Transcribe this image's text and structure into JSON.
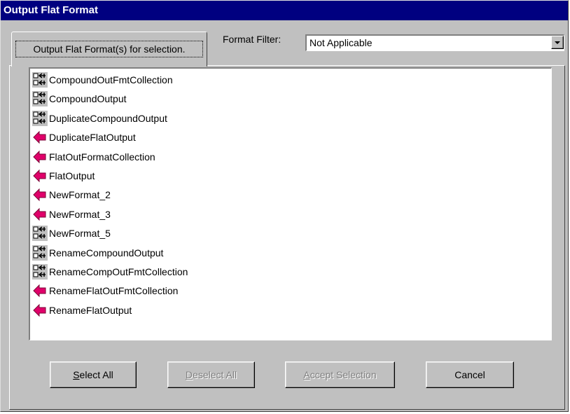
{
  "window": {
    "title": "Output Flat Format"
  },
  "tab": {
    "label": "Output Flat Format(s) for selection."
  },
  "filter": {
    "label": "Format Filter:",
    "value": "Not Applicable"
  },
  "list": {
    "items": [
      {
        "label": "CompoundOutFmtCollection",
        "icon": "compound-format-icon"
      },
      {
        "label": "CompoundOutput",
        "icon": "compound-format-icon"
      },
      {
        "label": "DuplicateCompoundOutput",
        "icon": "compound-format-icon"
      },
      {
        "label": "DuplicateFlatOutput",
        "icon": "flat-output-arrow-icon"
      },
      {
        "label": "FlatOutFormatCollection",
        "icon": "flat-output-arrow-icon"
      },
      {
        "label": "FlatOutput",
        "icon": "flat-output-arrow-icon"
      },
      {
        "label": "NewFormat_2",
        "icon": "flat-output-arrow-icon"
      },
      {
        "label": "NewFormat_3",
        "icon": "flat-output-arrow-icon"
      },
      {
        "label": "NewFormat_5",
        "icon": "compound-format-icon"
      },
      {
        "label": "RenameCompoundOutput",
        "icon": "compound-format-icon"
      },
      {
        "label": "RenameCompOutFmtCollection",
        "icon": "compound-format-icon"
      },
      {
        "label": "RenameFlatOutFmtCollection",
        "icon": "flat-output-arrow-icon"
      },
      {
        "label": "RenameFlatOutput",
        "icon": "flat-output-arrow-icon"
      }
    ]
  },
  "buttons": {
    "select_all": {
      "mnemonic": "S",
      "rest": "elect All",
      "enabled": true
    },
    "deselect_all": {
      "mnemonic": "D",
      "rest": "eselect All",
      "enabled": false
    },
    "accept_selection": {
      "mnemonic": "A",
      "rest": "ccept Selection",
      "enabled": false
    },
    "cancel": {
      "label": "Cancel",
      "enabled": true
    }
  },
  "colors": {
    "titlebar": "#000080",
    "face": "#c0c0c0",
    "flat_arrow": "#e0006a"
  }
}
